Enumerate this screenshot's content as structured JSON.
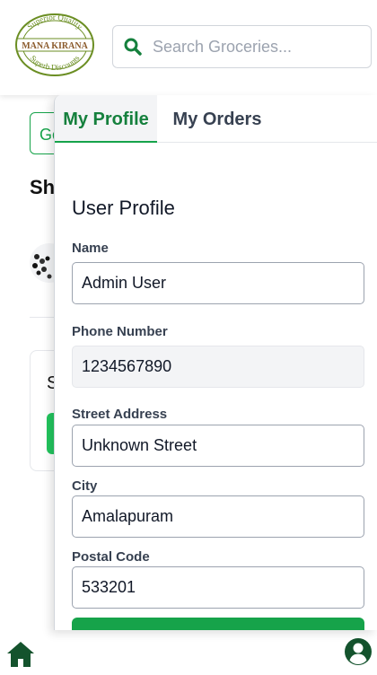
{
  "brand": {
    "name": "MANA KIRANA",
    "tagline_top": "Superior Quality",
    "tagline_bottom": "Superb Discounts",
    "color": "#2e7d32"
  },
  "search": {
    "placeholder": "Search Groceries...",
    "icon": "search-icon"
  },
  "background_page": {
    "button_partial": "Go",
    "heading_partial": "Sh",
    "card_text_partial": "S"
  },
  "drawer": {
    "tabs": [
      {
        "label": "My Profile",
        "active": true
      },
      {
        "label": "My Orders",
        "active": false
      }
    ],
    "section_title": "User Profile",
    "fields": {
      "name": {
        "label": "Name",
        "value": "Admin User"
      },
      "phone": {
        "label": "Phone Number",
        "value": "1234567890",
        "readonly": true
      },
      "street": {
        "label": "Street Address",
        "value": "Unknown Street"
      },
      "city": {
        "label": "City",
        "value": "Amalapuram"
      },
      "postal": {
        "label": "Postal Code",
        "value": "533201"
      }
    }
  },
  "bottom_nav": {
    "items": [
      "home-icon",
      "user-circle-icon"
    ]
  },
  "colors": {
    "accent": "#16a34a",
    "accent_dark": "#15803d",
    "nav_icon": "#14532d"
  }
}
